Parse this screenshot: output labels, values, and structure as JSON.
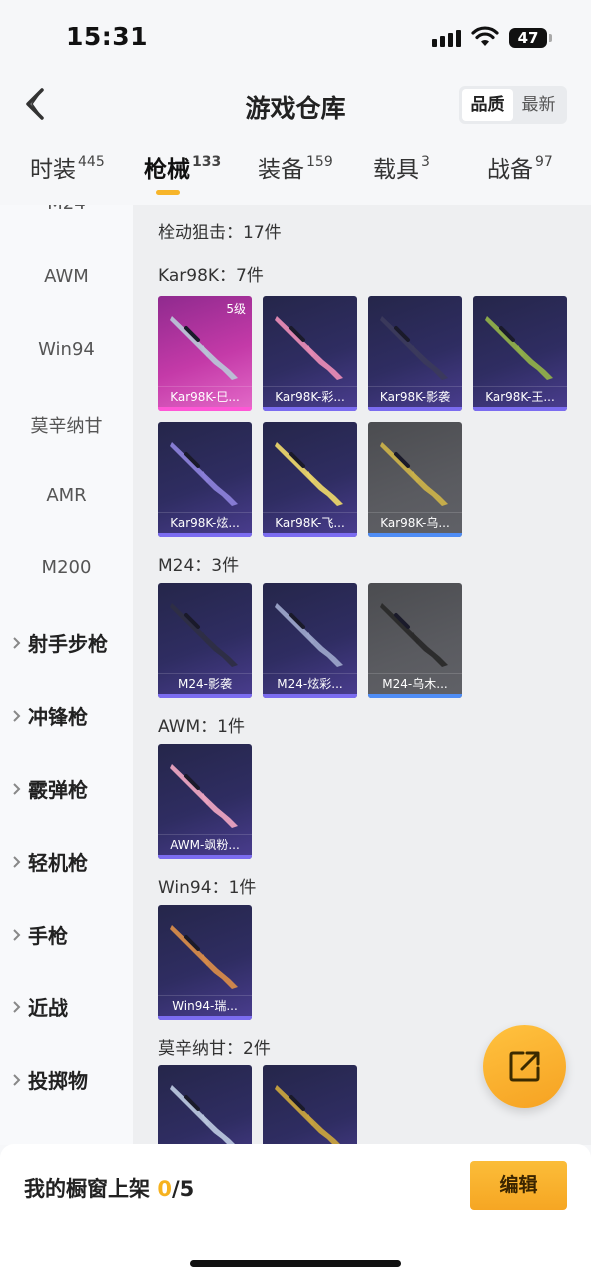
{
  "status_bar": {
    "time": "15:31",
    "battery": "47"
  },
  "header": {
    "title": "游戏仓库",
    "sort": [
      "品质",
      "最新"
    ]
  },
  "tabs": [
    {
      "label": "时装",
      "count": "445"
    },
    {
      "label": "枪械",
      "count": "133"
    },
    {
      "label": "装备",
      "count": "159"
    },
    {
      "label": "载具",
      "count": "3"
    },
    {
      "label": "战备",
      "count": "97"
    }
  ],
  "sidebar": {
    "partial_top": "M24",
    "subitems": [
      "AWM",
      "Win94",
      "莫辛纳甘",
      "AMR",
      "M200"
    ],
    "categories": [
      "射手步枪",
      "冲锋枪",
      "霰弹枪",
      "轻机枪",
      "手枪",
      "近战",
      "投掷物"
    ]
  },
  "content": {
    "group_title": "栓动狙击：17件",
    "sections": [
      {
        "label": "Kar98K：7件",
        "items": [
          "Kar98K-巳...",
          "Kar98K-彩...",
          "Kar98K-影袭",
          "Kar98K-王...",
          "Kar98K-炫...",
          "Kar98K-飞...",
          "Kar98K-乌..."
        ]
      },
      {
        "label": "M24：3件",
        "items": [
          "M24-影袭",
          "M24-炫彩...",
          "M24-乌木..."
        ]
      },
      {
        "label": "AWM：1件",
        "items": [
          "AWM-飒粉..."
        ]
      },
      {
        "label": "Win94：1件",
        "items": [
          "Win94-瑞..."
        ]
      },
      {
        "label": "莫辛纳甘：2件",
        "items": [
          "",
          ""
        ]
      }
    ],
    "level_badge": "5级"
  },
  "bottom": {
    "showcase_label": "我的橱窗上架",
    "current": "0",
    "total": "/5",
    "edit_label": "编辑"
  },
  "colors": {
    "accent": "#f6a623",
    "rarity_purple": "#7b6cf0",
    "rarity_pink": "#ff56d6",
    "rarity_blue": "#4f8df5"
  },
  "icons": {
    "back": "back-chevron-icon",
    "share": "share-icon",
    "expand": "chevron-right-icon"
  }
}
